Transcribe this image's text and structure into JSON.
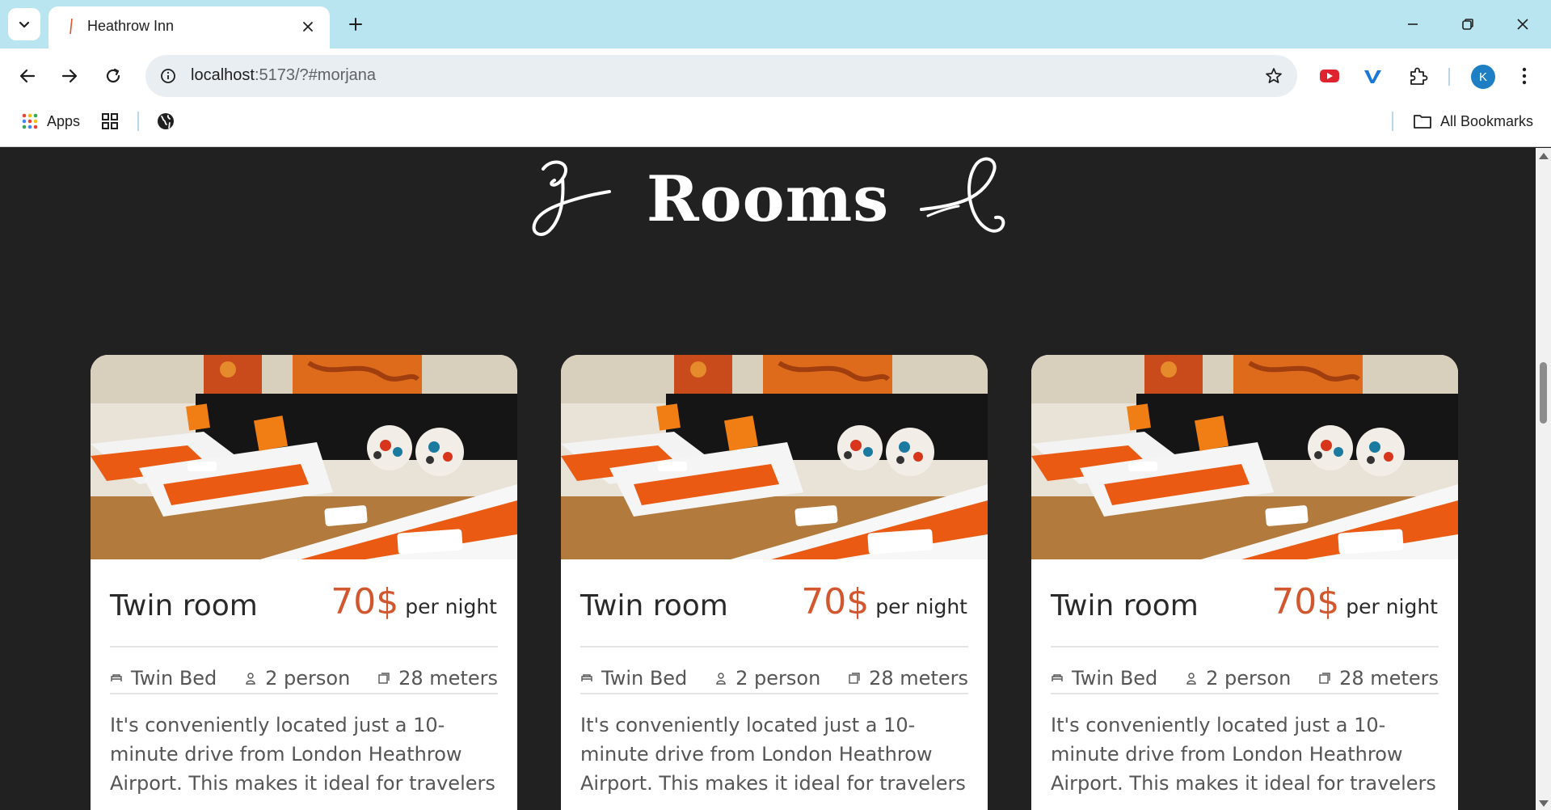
{
  "browser": {
    "tab_title": "Heathrow Inn",
    "url_host": "localhost",
    "url_path": ":5173/?#morjana",
    "bookmarks": {
      "apps_label": "Apps",
      "all_bookmarks_label": "All Bookmarks"
    },
    "avatar_letter": "K",
    "icons": [
      "tab-search-icon",
      "close-icon",
      "plus-icon",
      "minimize-icon",
      "restore-icon",
      "back-icon",
      "forward-icon",
      "reload-icon",
      "info-icon",
      "star-icon",
      "youtube-extension-icon",
      "vimeo-extension-icon",
      "puzzle-icon",
      "kebab-icon",
      "apps-grid-icon",
      "globe-icon",
      "folder-icon"
    ]
  },
  "page": {
    "heading": "Rooms",
    "cards": [
      {
        "title": "Twin room",
        "price": "70$",
        "per_night": "per night",
        "amenities": {
          "bed": "Twin Bed",
          "persons": "2 person",
          "size": "28 meters"
        },
        "description": "It's conveniently located just a 10-minute drive from London Heathrow Airport. This makes it ideal for travelers"
      },
      {
        "title": "Twin room",
        "price": "70$",
        "per_night": "per night",
        "amenities": {
          "bed": "Twin Bed",
          "persons": "2 person",
          "size": "28 meters"
        },
        "description": "It's conveniently located just a 10-minute drive from London Heathrow Airport. This makes it ideal for travelers"
      },
      {
        "title": "Twin room",
        "price": "70$",
        "per_night": "per night",
        "amenities": {
          "bed": "Twin Bed",
          "persons": "2 person",
          "size": "28 meters"
        },
        "description": "It's conveniently located just a 10-minute drive from London Heathrow Airport. This makes it ideal for travelers"
      }
    ]
  },
  "colors": {
    "page_bg": "#212121",
    "accent_price": "#d2572e",
    "tabbar_bg": "#b9e5f1",
    "card_bg": "#ffffff"
  }
}
